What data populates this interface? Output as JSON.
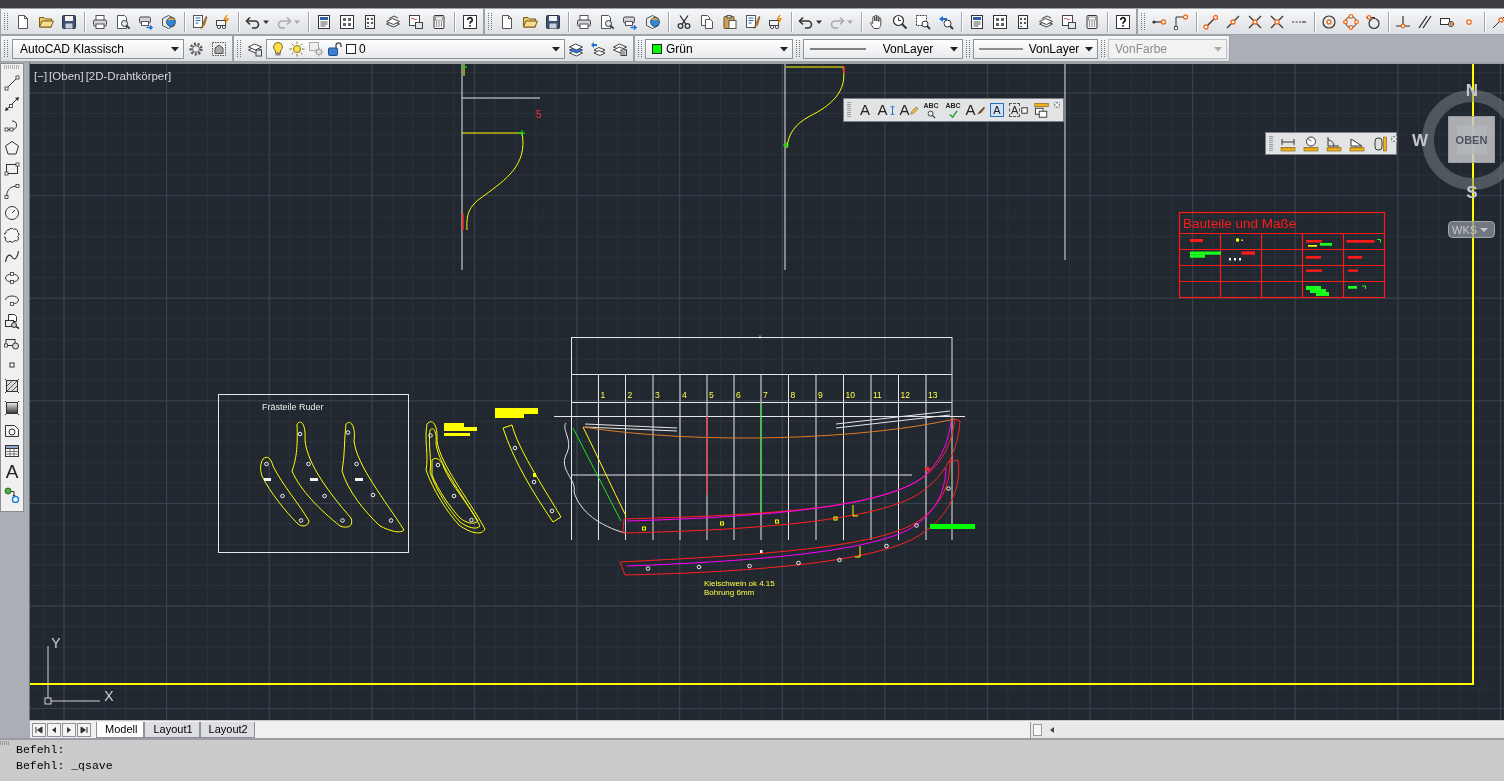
{
  "standard_toolbars": [
    {
      "history_buttons": [
        {
          "kind": "undo",
          "disabled": false
        },
        {
          "kind": "redo",
          "disabled": true
        }
      ]
    },
    {
      "history_buttons": [
        {
          "kind": "undo",
          "disabled": false
        },
        {
          "kind": "redo",
          "disabled": true
        }
      ]
    }
  ],
  "workspace": {
    "value": "AutoCAD Klassisch"
  },
  "layer_control": {
    "on": true,
    "frozen": false,
    "locked": false,
    "color": "#ffffff",
    "value": "0"
  },
  "color_control": {
    "value": "Grün",
    "color": "#00ff00"
  },
  "linetype_control": {
    "value": "VonLayer"
  },
  "lineweight_control": {
    "value": "VonLayer"
  },
  "plotstyle_control": {
    "value": "VonFarbe",
    "disabled": true
  },
  "draw_toolbar": {
    "text_tool": "A"
  },
  "viewport_controls": [
    "[−]",
    "[Oben]",
    "[2D-Drahtkörper]"
  ],
  "text_toolbar": {
    "tools": [
      {
        "kind": "mtext",
        "glyph": "A"
      },
      {
        "kind": "dtext",
        "glyph": "A"
      },
      {
        "kind": "edit",
        "glyph": "A"
      },
      {
        "kind": "find",
        "glyph": "ABC"
      },
      {
        "kind": "spell",
        "glyph": "ABC"
      },
      {
        "kind": "style",
        "glyph": "A"
      },
      {
        "kind": "scale",
        "glyph": "A"
      },
      {
        "kind": "justify",
        "glyph": "A"
      },
      {
        "kind": "frame"
      }
    ]
  },
  "viewcube": {
    "north": "N",
    "west": "W",
    "south": "S",
    "face": "OBEN",
    "ucs_menu": "WKS"
  },
  "drawing": {
    "profile_label": "5",
    "rudder_panel_title": "Frästeile Ruder",
    "station_numbers": [
      "1",
      "2",
      "3",
      "4",
      "5",
      "6",
      "7",
      "8",
      "9",
      "10",
      "11",
      "12",
      "13"
    ],
    "notes": [
      "Kielschwein ok 4.15",
      "Bohrung 6mm"
    ],
    "parts_table_title": "Bauteile und Maße"
  },
  "ucs_icon": {
    "x": "X",
    "y": "Y"
  },
  "layout_tabs": [
    {
      "label": "Modell",
      "selected": true
    },
    {
      "label": "Layout1",
      "selected": false
    },
    {
      "label": "Layout2",
      "selected": false
    }
  ],
  "command_history": [
    "Befehl:",
    "Befehl: _qsave"
  ]
}
